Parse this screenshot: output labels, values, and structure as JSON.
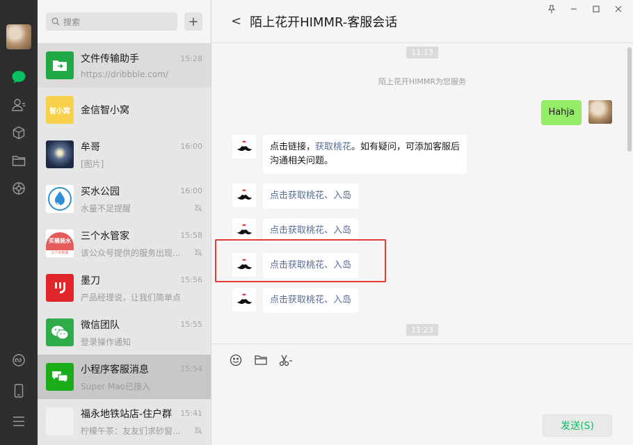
{
  "search": {
    "placeholder": "搜索"
  },
  "chats": [
    {
      "name": "文件传输助手",
      "time": "15:28",
      "sub": "https://dribbble.com/",
      "muted": false
    },
    {
      "name": "金信智小窝",
      "time": "",
      "sub": "",
      "muted": false
    },
    {
      "name": "牟哥",
      "time": "16:00",
      "sub": "[图片]",
      "muted": false
    },
    {
      "name": "买水公园",
      "time": "16:00",
      "sub": "水量不足提醒",
      "muted": true
    },
    {
      "name": "三个水管家",
      "time": "15:58",
      "sub": "该公众号提供的服务出现...",
      "muted": true
    },
    {
      "name": "墨刀",
      "time": "15:56",
      "sub": "产品经理说，让我们简单点",
      "muted": false
    },
    {
      "name": "微信团队",
      "time": "15:55",
      "sub": "登录操作通知",
      "muted": false
    },
    {
      "name": "小程序客服消息",
      "time": "15:54",
      "sub": "Super Mao已接入",
      "muted": false
    },
    {
      "name": "福永地铁站店-住户群",
      "time": "15:41",
      "sub": "柠檬午茶：友友们求砂窗...",
      "muted": true
    }
  ],
  "avatar_text": {
    "jinxin": "智小窝",
    "shuiguanjia": "买桶装水",
    "shuiguanjia_small": "三个水管家"
  },
  "chat_header": {
    "title": "陌上花开HIMMR-客服会话",
    "back": "<"
  },
  "messages": {
    "time1": "11:13",
    "system": "陌上花开HIMMR为您服务",
    "my_text": "Hahja",
    "bot1_prefix": "点击链接，",
    "bot1_link": "获取桃花",
    "bot1_suffix": "。如有疑问，可添加客服后",
    "bot1_line2": "沟通相关问题。",
    "bot_link_msgs": [
      "点击获取桃花、入岛",
      "点击获取桃花、入岛",
      "点击获取桃花、入岛",
      "点击获取桃花、入岛"
    ],
    "time2": "11:23"
  },
  "composer": {
    "send_label": "发送(S)"
  },
  "colors": {
    "accent_green": "#07c160",
    "bubble_green": "#95ec69",
    "link_blue": "#576b95",
    "highlight_red": "#e53935"
  }
}
